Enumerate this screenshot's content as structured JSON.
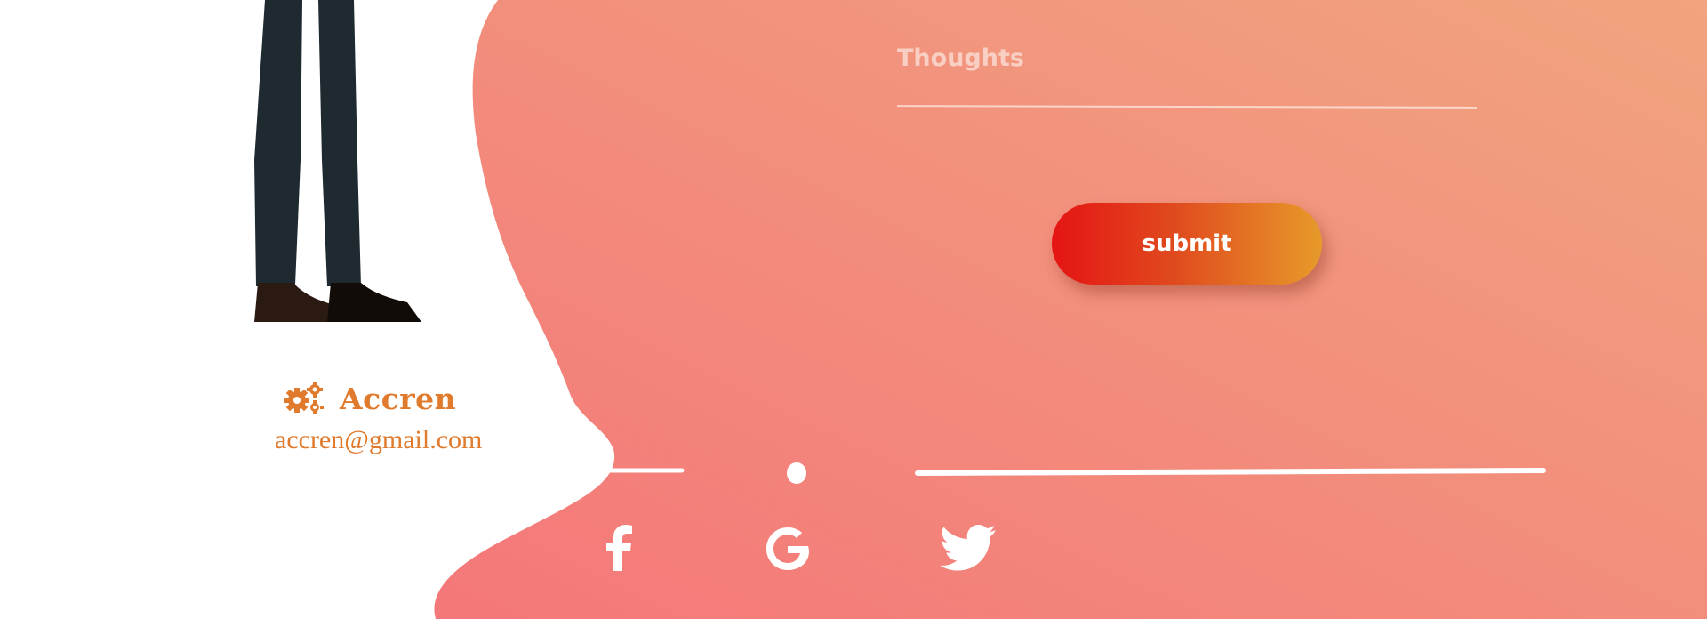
{
  "brand": {
    "name": "Accren",
    "email": "accren@gmail.com",
    "icon": "gears-icon",
    "color": "#e07a2c"
  },
  "form": {
    "thoughts_placeholder": "Thoughts",
    "submit_label": "submit"
  },
  "social": [
    {
      "name": "Facebook",
      "icon": "facebook-icon"
    },
    {
      "name": "Google",
      "icon": "google-icon"
    },
    {
      "name": "Twitter",
      "icon": "twitter-icon"
    }
  ],
  "colors": {
    "background_gradient_start": "#f47a7a",
    "background_gradient_end": "#f1a47e",
    "button_gradient_start": "#e51414",
    "button_gradient_end": "#e79a2a"
  }
}
